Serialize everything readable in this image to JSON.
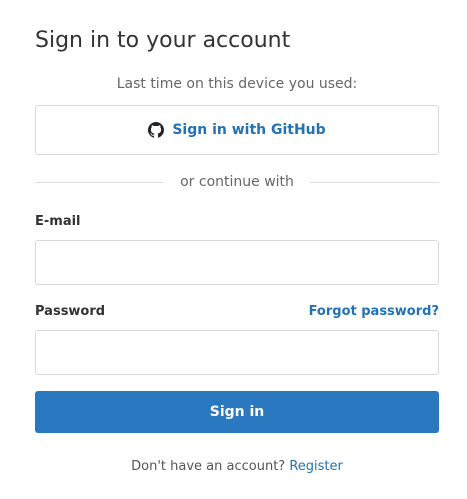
{
  "title": "Sign in to your account",
  "last_used_text": "Last time on this device you used:",
  "github_button": {
    "label": "Sign in with GitHub",
    "icon": "github-icon"
  },
  "divider_text": "or continue with",
  "email": {
    "label": "E-mail",
    "value": "",
    "placeholder": ""
  },
  "password": {
    "label": "Password",
    "value": "",
    "placeholder": "",
    "forgot_link": "Forgot password?"
  },
  "submit_label": "Sign in",
  "footer": {
    "text": "Don't have an account?",
    "link": "Register"
  },
  "colors": {
    "accent": "#2a78bf",
    "link": "#2272b5",
    "border": "#d9d9d9"
  }
}
